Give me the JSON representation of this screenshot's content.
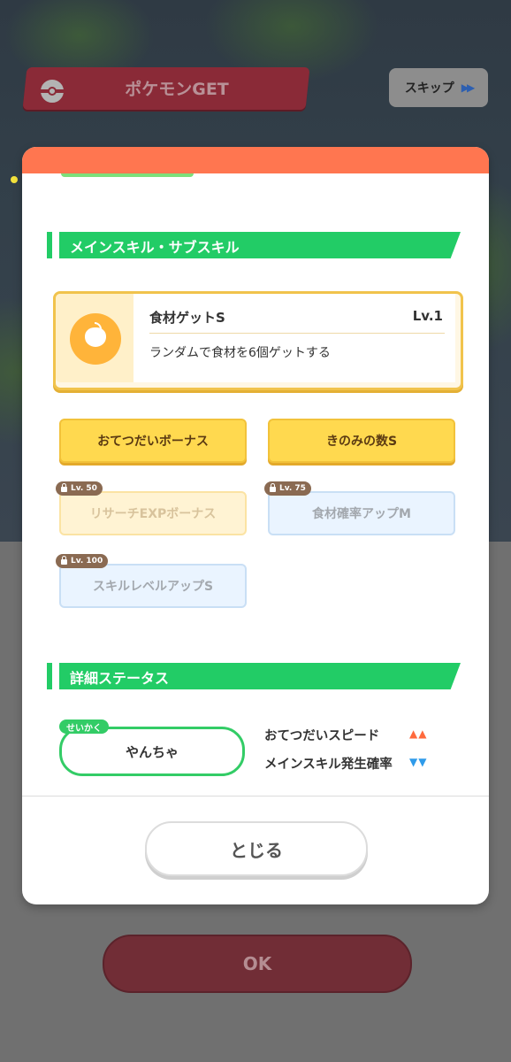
{
  "background": {
    "banner_title": "ポケモンGET",
    "skip_label": "スキップ",
    "skip_arrow_glyph": "▶▶",
    "ok_label": "OK"
  },
  "modal": {
    "header_color": "#ff7650",
    "section_skills": {
      "title": "メインスキル・サブスキル",
      "main_skill": {
        "name": "食材ゲットS",
        "level": "Lv.1",
        "description": "ランダムで食材を6個ゲットする",
        "icon": "apple-icon"
      },
      "sub_skills": [
        {
          "label": "おてつだいボーナス",
          "locked": false,
          "lock_level": ""
        },
        {
          "label": "きのみの数S",
          "locked": false,
          "lock_level": ""
        },
        {
          "label": "リサーチEXPボーナス",
          "locked": true,
          "lock_level": "Lv. 50"
        },
        {
          "label": "食材確率アップM",
          "locked": true,
          "lock_level": "Lv. 75"
        },
        {
          "label": "スキルレベルアップS",
          "locked": true,
          "lock_level": "Lv. 100"
        }
      ]
    },
    "section_status": {
      "title": "詳細ステータス",
      "nature_tag": "せいかく",
      "nature_value": "やんちゃ",
      "stats": [
        {
          "label": "おてつだいスピード",
          "arrows": "▲▲",
          "color": "#ff6a3d"
        },
        {
          "label": "メインスキル発生確率",
          "arrows": "▼▼",
          "color": "#2f9bea"
        }
      ]
    },
    "close_label": "とじる"
  }
}
